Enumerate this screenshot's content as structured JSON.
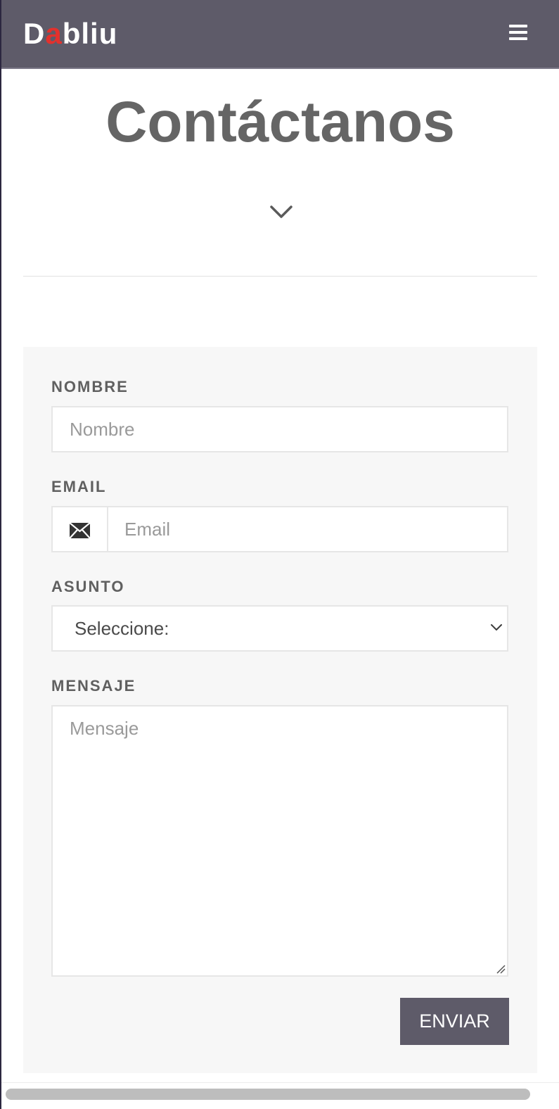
{
  "header": {
    "logo_first": "D",
    "logo_accent": "a",
    "logo_rest": "bliu",
    "menu_icon": "hamburger-menu-icon",
    "background_color": "#5e5b69",
    "accent_color": "#e3312d"
  },
  "hero": {
    "title": "Contáctanos",
    "scroll_icon": "chevron-down-icon"
  },
  "form": {
    "name": {
      "label": "NOMBRE",
      "placeholder": "Nombre"
    },
    "email": {
      "label": "EMAIL",
      "placeholder": "Email",
      "icon": "envelope-icon"
    },
    "subject": {
      "label": "ASUNTO",
      "selected": "Seleccione:",
      "icon": "chevron-down-icon"
    },
    "message": {
      "label": "MENSAJE",
      "placeholder": "Mensaje"
    },
    "submit_label": "ENVIAR"
  }
}
